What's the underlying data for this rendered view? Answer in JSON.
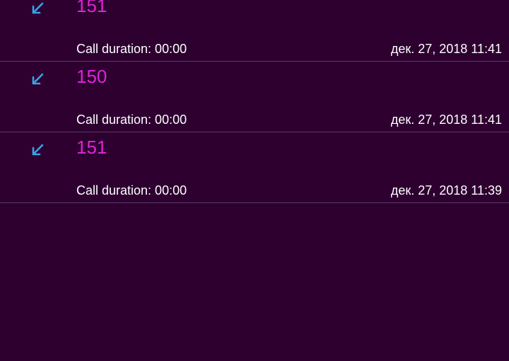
{
  "colors": {
    "background": "#2d0030",
    "divider": "#5a3a60",
    "number": "#e023d6",
    "incoming_icon": "#3aa3e6",
    "text": "#ffffff"
  },
  "calls": [
    {
      "number": "151",
      "duration": "Call duration: 00:00",
      "date": "дек. 27, 2018 11:41",
      "icon": "incoming-call-arrow-icon"
    },
    {
      "number": "150",
      "duration": "Call duration: 00:00",
      "date": "дек. 27, 2018 11:41",
      "icon": "incoming-call-arrow-icon"
    },
    {
      "number": "151",
      "duration": "Call duration: 00:00",
      "date": "дек. 27, 2018 11:39",
      "icon": "incoming-call-arrow-icon"
    }
  ]
}
